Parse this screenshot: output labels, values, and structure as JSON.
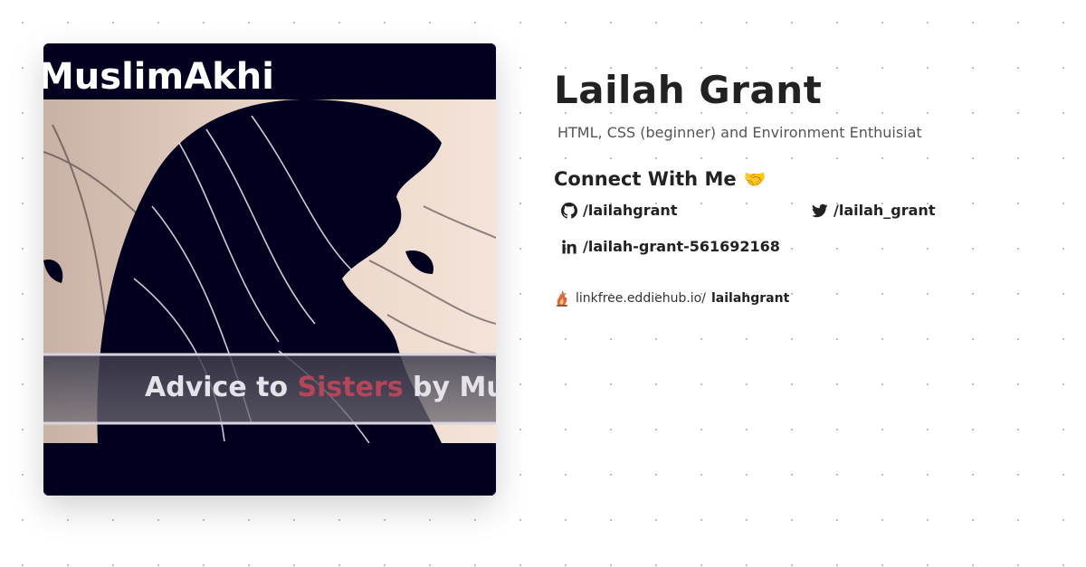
{
  "profile": {
    "name": "Lailah Grant",
    "bio": "HTML, CSS (beginner) and Environment Enthuisiat"
  },
  "avatar": {
    "top_text": "MuslimAkhi",
    "caption_part1": "Advice to ",
    "caption_part2": "Sisters",
    "caption_part3": " by Muf"
  },
  "connect": {
    "heading": "Connect With Me",
    "emoji": "🤝"
  },
  "socials": {
    "github": {
      "icon": "github-icon",
      "handle": "/lailahgrant"
    },
    "twitter": {
      "icon": "twitter-icon",
      "handle": "/lailah_grant"
    },
    "linkedin": {
      "icon": "linkedin-icon",
      "handle": "/lailah-grant-561692168"
    }
  },
  "linkfree": {
    "icon": "linkfree-icon",
    "domain": "linkfree.eddiehub.io/",
    "username": "lailahgrant"
  },
  "colors": {
    "text": "#222222",
    "muted": "#555555",
    "avatar_dark": "#02001f",
    "avatar_light": "#f1ddd0",
    "sisters_accent": "#b7455a"
  }
}
